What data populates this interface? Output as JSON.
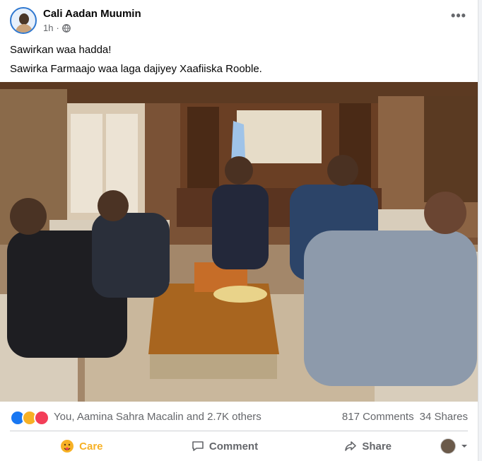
{
  "post": {
    "author": "Cali Aadan Muumin",
    "time": "1h",
    "more_label": "•••",
    "line1": "Sawirkan waa hadda!",
    "line2": "Sawirka Farmaajo waa laga dajiyey Xaafiiska Rooble."
  },
  "stats": {
    "reactions_text": "You, Aamina Sahra Macalin and 2.7K others",
    "comments": "817 Comments",
    "shares": "34 Shares",
    "reaction_icons": [
      "like-icon",
      "haha-icon",
      "love-icon"
    ]
  },
  "actions": {
    "care": "Care",
    "comment": "Comment",
    "share": "Share"
  },
  "colors": {
    "brand_blue": "#1877f2",
    "care_yellow": "#f7b125",
    "love_red": "#f33e58"
  }
}
